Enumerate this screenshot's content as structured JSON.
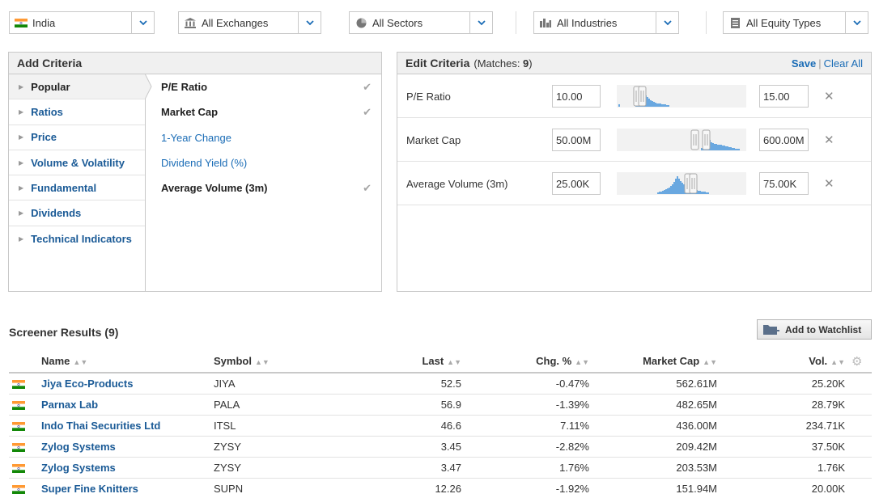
{
  "filters": {
    "country": "India",
    "exchanges": "All Exchanges",
    "sectors": "All Sectors",
    "industries": "All Industries",
    "equity_types": "All Equity Types"
  },
  "add_criteria": {
    "title": "Add Criteria",
    "menu": [
      {
        "label": "Popular",
        "active": true
      },
      {
        "label": "Ratios"
      },
      {
        "label": "Price"
      },
      {
        "label": "Volume & Volatility"
      },
      {
        "label": "Fundamental"
      },
      {
        "label": "Dividends"
      },
      {
        "label": "Technical Indicators"
      }
    ],
    "criteria": [
      {
        "label": "P/E Ratio",
        "selected": true
      },
      {
        "label": "Market Cap",
        "selected": true
      },
      {
        "label": "1-Year Change",
        "selected": false
      },
      {
        "label": "Dividend Yield (%)",
        "selected": false
      },
      {
        "label": "Average Volume (3m)",
        "selected": true
      }
    ]
  },
  "edit_criteria": {
    "title": "Edit Criteria",
    "matches_prefix": "(Matches: ",
    "matches_count": "9",
    "matches_suffix": ")",
    "save_label": "Save",
    "separator": "|",
    "clear_label": "Clear All",
    "rows": [
      {
        "name": "P/E Ratio",
        "min": "10.00",
        "max": "15.00"
      },
      {
        "name": "Market Cap",
        "min": "50.00M",
        "max": "600.00M"
      },
      {
        "name": "Average Volume (3m)",
        "min": "25.00K",
        "max": "75.00K"
      }
    ]
  },
  "results": {
    "title": "Screener Results (9)",
    "watchlist_label": "Add to Watchlist",
    "columns": [
      "Name",
      "Symbol",
      "Last",
      "Chg. %",
      "Market Cap",
      "Vol."
    ],
    "rows": [
      {
        "name": "Jiya Eco-Products",
        "symbol": "JIYA",
        "last": "52.5",
        "chg": "-0.47%",
        "mcap": "562.61M",
        "vol": "25.20K"
      },
      {
        "name": "Parnax Lab",
        "symbol": "PALA",
        "last": "56.9",
        "chg": "-1.39%",
        "mcap": "482.65M",
        "vol": "28.79K"
      },
      {
        "name": "Indo Thai Securities Ltd",
        "symbol": "ITSL",
        "last": "46.6",
        "chg": "7.11%",
        "mcap": "436.00M",
        "vol": "234.71K"
      },
      {
        "name": "Zylog Systems",
        "symbol": "ZYSY",
        "last": "3.45",
        "chg": "-2.82%",
        "mcap": "209.42M",
        "vol": "37.50K"
      },
      {
        "name": "Zylog Systems",
        "symbol": "ZYSY",
        "last": "3.47",
        "chg": "1.76%",
        "mcap": "203.53M",
        "vol": "1.76K"
      },
      {
        "name": "Super Fine Knitters",
        "symbol": "SUPN",
        "last": "12.26",
        "chg": "-1.92%",
        "mcap": "151.94M",
        "vol": "20.00K"
      }
    ]
  },
  "colors": {
    "link": "#1a6cb6",
    "menu_link": "#1a5a96",
    "histogram": "#6aa8e0",
    "flag_saffron": "#ff9933",
    "flag_green": "#138808"
  },
  "icons": [
    "india-flag-icon",
    "exchange-building-icon",
    "pie-chart-icon",
    "bar-chart-icon",
    "document-icon",
    "chevron-down-icon",
    "checkmark-icon",
    "remove-x-icon",
    "add-watchlist-icon",
    "sort-icon",
    "settings-gear-icon"
  ]
}
